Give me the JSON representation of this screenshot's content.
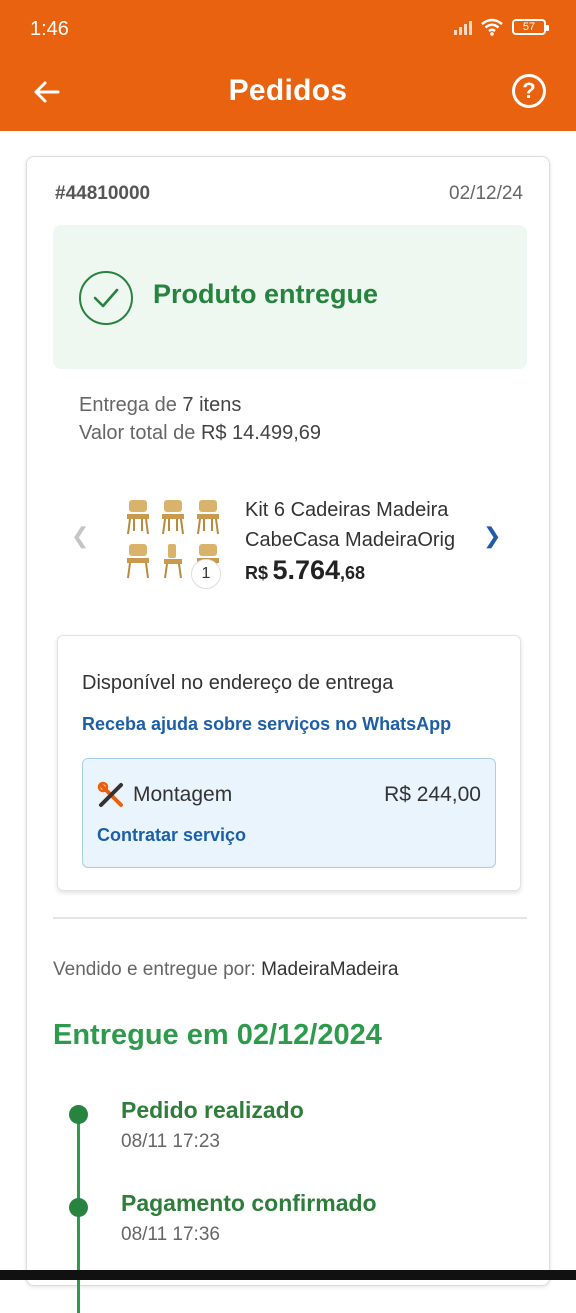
{
  "status_bar": {
    "time": "1:46",
    "battery": "57"
  },
  "app_bar": {
    "title": "Pedidos"
  },
  "order": {
    "id": "#44810000",
    "date": "02/12/24",
    "status": "Produto entregue",
    "summary": {
      "delivery_prefix": "Entrega de ",
      "items": "7 itens",
      "total_prefix": "Valor total de ",
      "total": "R$ 14.499,69"
    },
    "product": {
      "name": "Kit 6 Cadeiras Madeira CabeCasa MadeiraOrig",
      "qty": "1",
      "price_currency": "R$",
      "price_int": "5.764",
      "price_cents": ",68"
    },
    "services": {
      "heading": "Disponível no endereço de entrega",
      "whatsapp_link": "Receba ajuda sobre serviços no WhatsApp",
      "service_name": "Montagem",
      "service_price": "R$ 244,00",
      "hire_label": "Contratar serviço"
    },
    "seller": {
      "prefix": "Vendido e entregue por: ",
      "name": "MadeiraMadeira"
    },
    "delivered_label": "Entregue em 02/12/2024",
    "timeline": [
      {
        "title": "Pedido realizado",
        "time": "08/11 17:23"
      },
      {
        "title": "Pagamento confirmado",
        "time": "08/11 17:36"
      }
    ]
  },
  "colors": {
    "brand": "#E8620F",
    "success": "#26843E",
    "link": "#1D5FA7"
  },
  "icons": {
    "back": "arrow-left-icon",
    "help": "help-circle-icon",
    "check": "check-circle-icon",
    "tools": "tools-icon",
    "prev": "chevron-left-icon",
    "next": "chevron-right-icon"
  }
}
